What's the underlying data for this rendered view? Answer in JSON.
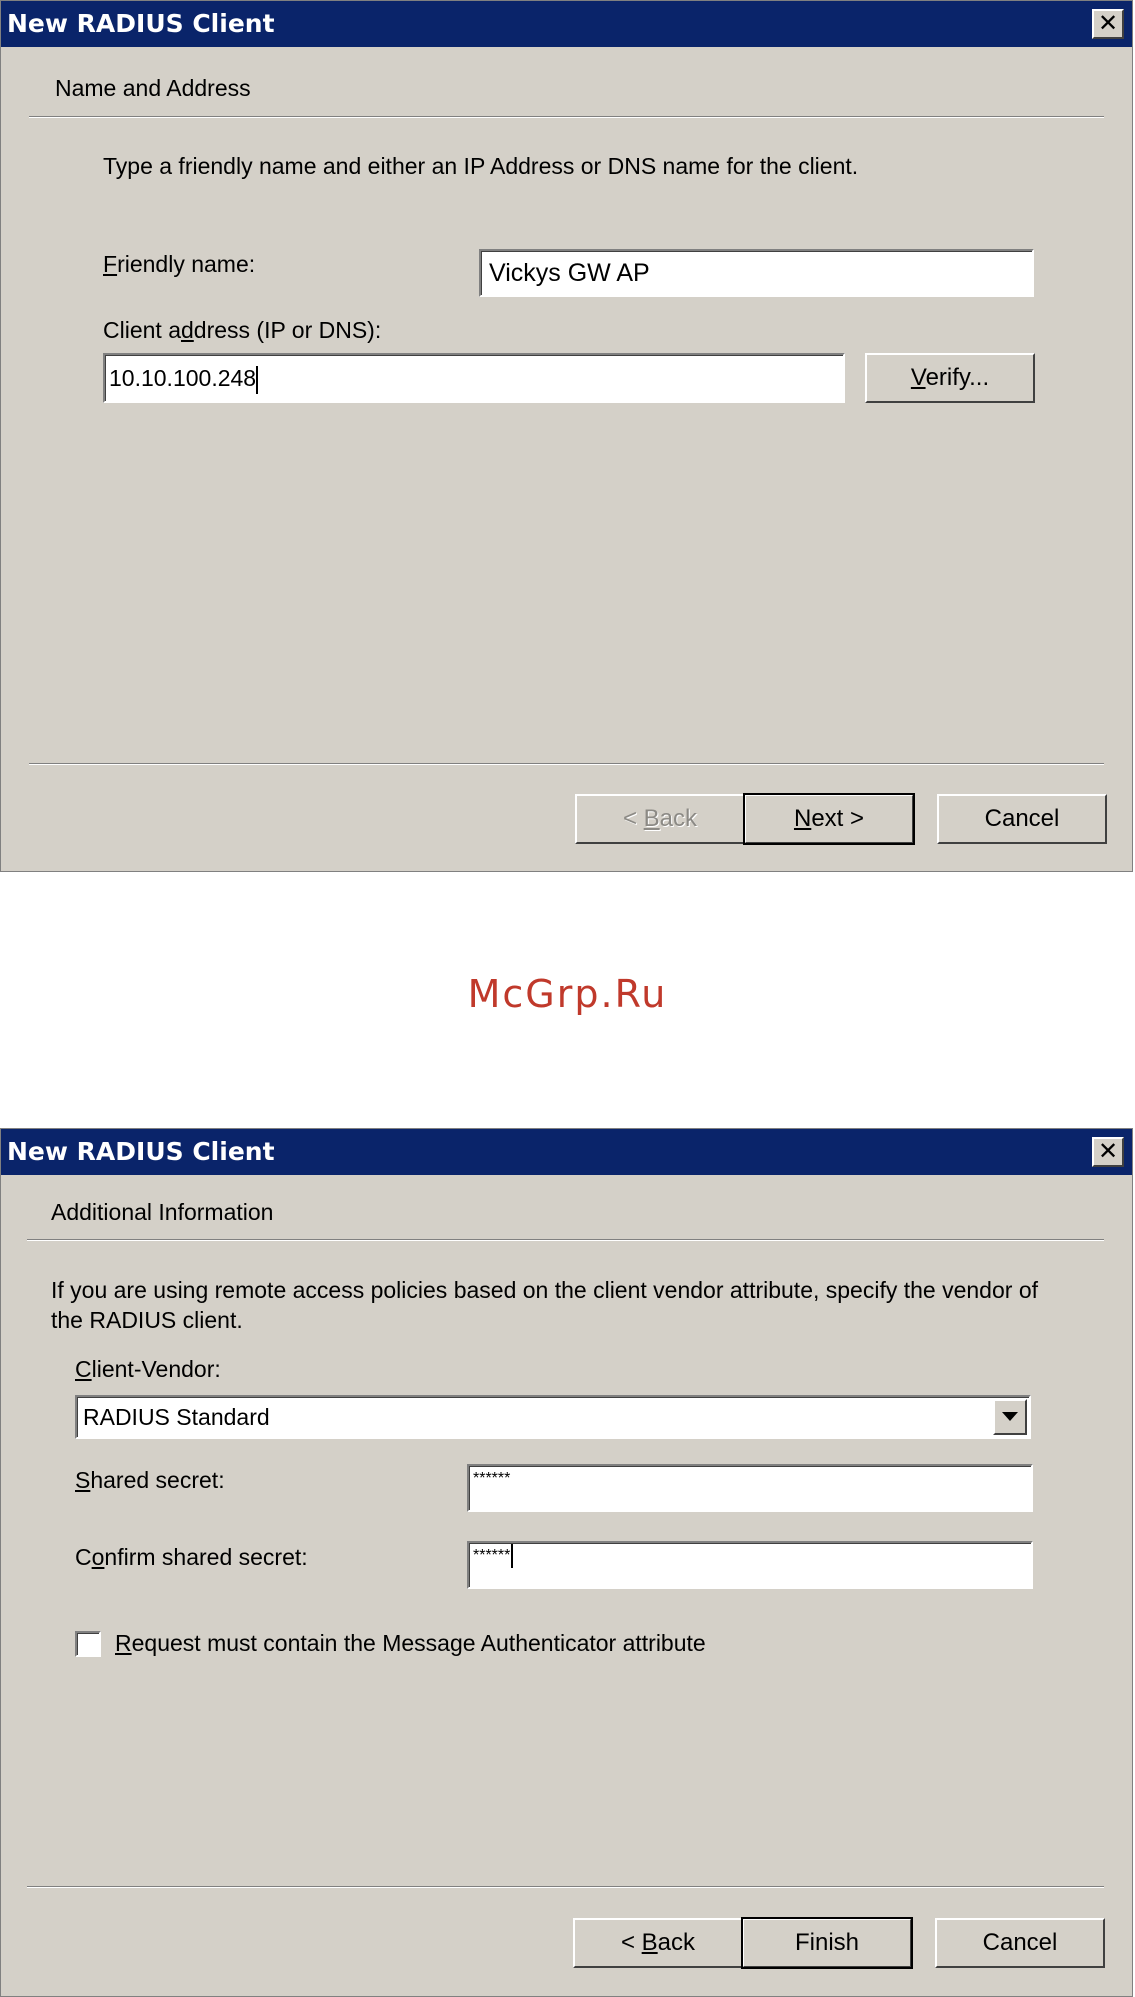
{
  "dialog1": {
    "title": "New RADIUS Client",
    "heading": "Name and Address",
    "instruction": "Type a friendly name and either an IP Address or DNS name for the client.",
    "friendly_name": {
      "label_mnemonic": "F",
      "label_rest": "riendly name:",
      "value": "Vickys GW AP"
    },
    "client_address": {
      "label_pre": "Client a",
      "label_mnemonic": "d",
      "label_post": "dress (IP or DNS):",
      "value": "10.10.100.248"
    },
    "verify": {
      "mnemonic": "V",
      "rest": "erify..."
    },
    "back": {
      "pre": "< ",
      "mnemonic": "B",
      "rest": "ack"
    },
    "next": {
      "mnemonic": "N",
      "rest": "ext >"
    },
    "cancel": "Cancel"
  },
  "watermark": "McGrp.Ru",
  "dialog2": {
    "title": "New RADIUS Client",
    "heading": "Additional Information",
    "instruction": "If you are using remote access policies based on the client vendor attribute, specify the vendor of the RADIUS client.",
    "client_vendor": {
      "label_mnemonic": "C",
      "label_rest": "lient-Vendor:",
      "value": "RADIUS Standard"
    },
    "shared_secret": {
      "label_mnemonic": "S",
      "label_rest": "hared secret:",
      "value": "******"
    },
    "confirm_secret": {
      "label_pre": "C",
      "label_mnemonic": "o",
      "label_post": "nfirm shared secret:",
      "value": "******"
    },
    "message_auth": {
      "label_mnemonic": "R",
      "label_rest": "equest must contain the Message Authenticator attribute",
      "checked": false
    },
    "back": {
      "pre": "< ",
      "mnemonic": "B",
      "rest": "ack"
    },
    "finish": "Finish",
    "cancel": "Cancel"
  }
}
